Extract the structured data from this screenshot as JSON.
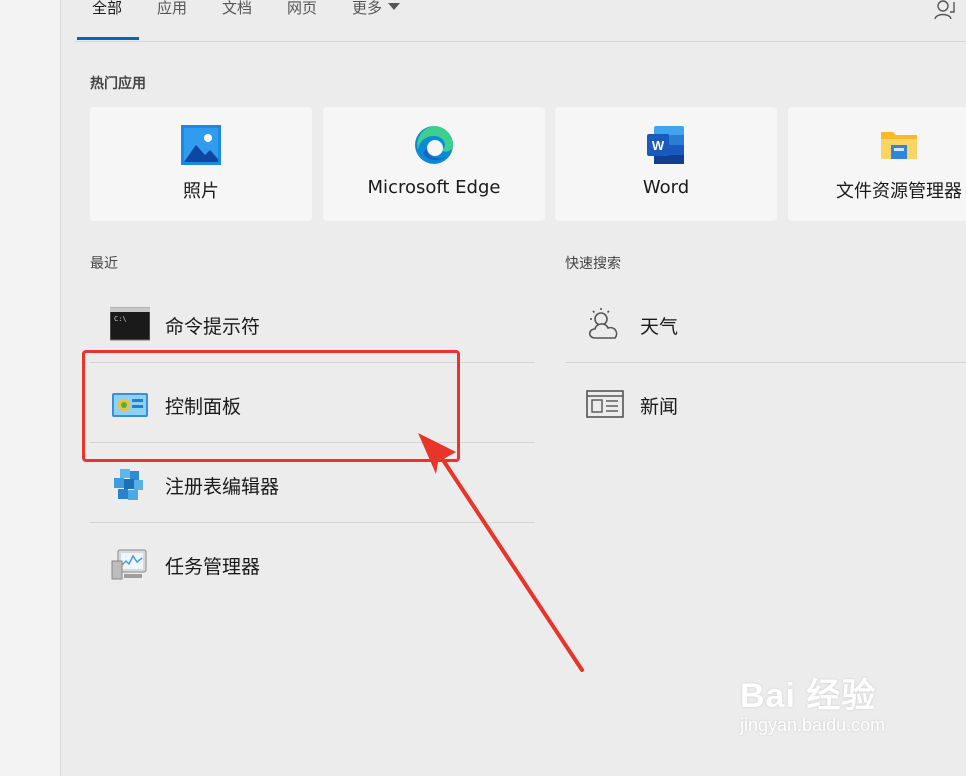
{
  "tabs": [
    {
      "label": "全部",
      "active": true
    },
    {
      "label": "应用",
      "active": false
    },
    {
      "label": "文档",
      "active": false
    },
    {
      "label": "网页",
      "active": false
    },
    {
      "label": "更多",
      "active": false,
      "has_dropdown": true
    }
  ],
  "header": {
    "account_icon": "person-feedback-icon"
  },
  "top_apps": {
    "label": "热门应用",
    "items": [
      {
        "label": "照片",
        "icon": "photos-icon"
      },
      {
        "label": "Microsoft Edge",
        "icon": "edge-icon"
      },
      {
        "label": "Word",
        "icon": "word-icon"
      },
      {
        "label": "文件资源管理器",
        "icon": "file-explorer-icon"
      }
    ]
  },
  "recent": {
    "label": "最近",
    "items": [
      {
        "label": "命令提示符",
        "icon": "cmd-icon"
      },
      {
        "label": "控制面板",
        "icon": "control-panel-icon",
        "highlighted": true
      },
      {
        "label": "注册表编辑器",
        "icon": "regedit-icon"
      },
      {
        "label": "任务管理器",
        "icon": "task-manager-icon"
      }
    ]
  },
  "quick_search": {
    "label": "快速搜索",
    "items": [
      {
        "label": "天气",
        "icon": "weather-icon"
      },
      {
        "label": "新闻",
        "icon": "news-icon"
      }
    ]
  },
  "annotation": {
    "highlight_color": "#e8342a",
    "accent_color": "#0067c0"
  },
  "watermark": {
    "main": "Bai 经验",
    "sub": "jingyan.baidu.com"
  }
}
